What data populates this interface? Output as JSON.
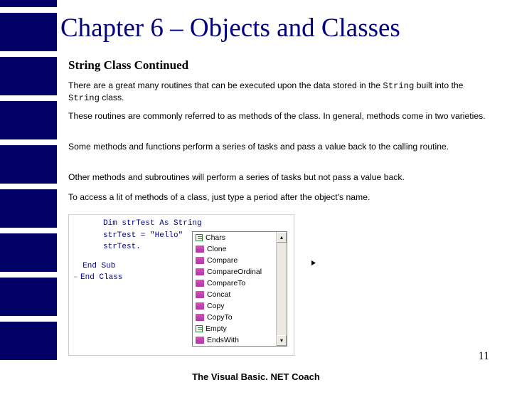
{
  "title": "Chapter 6 – Objects and Classes",
  "subtitle": "String Class Continued",
  "p1_a": "There are a great many routines that can be executed upon the data stored in the ",
  "p1_code1": "String",
  "p1_b": " built into the ",
  "p1_code2": "String",
  "p1_c": " class.",
  "p2": "These routines are commonly referred to as methods of the class. In general, methods come in two varieties.",
  "p3": "Some methods and functions perform a series of tasks and pass a value back to the calling routine.",
  "p4": "Other methods and subroutines will perform a series of tasks but not pass a value back.",
  "p5": "To access a lit of methods of a class, just type a period after the object's name.",
  "code": {
    "l1": "Dim strTest As String",
    "l2": "strTest = \"Hello\"",
    "l3": "strTest.",
    "end1": "  End Sub",
    "end2": "End Class",
    "dash": "–"
  },
  "intelli": {
    "items": [
      {
        "icon": "p",
        "label": "Chars"
      },
      {
        "icon": "m",
        "label": "Clone"
      },
      {
        "icon": "m",
        "label": "Compare"
      },
      {
        "icon": "m",
        "label": "CompareOrdinal"
      },
      {
        "icon": "m",
        "label": "CompareTo"
      },
      {
        "icon": "m",
        "label": "Concat"
      },
      {
        "icon": "m",
        "label": "Copy"
      },
      {
        "icon": "m",
        "label": "CopyTo"
      },
      {
        "icon": "p",
        "label": "Empty"
      },
      {
        "icon": "m",
        "label": "EndsWith"
      }
    ],
    "up": "▴",
    "down": "▾"
  },
  "pagenum": "11",
  "footer": "The Visual Basic. NET Coach"
}
